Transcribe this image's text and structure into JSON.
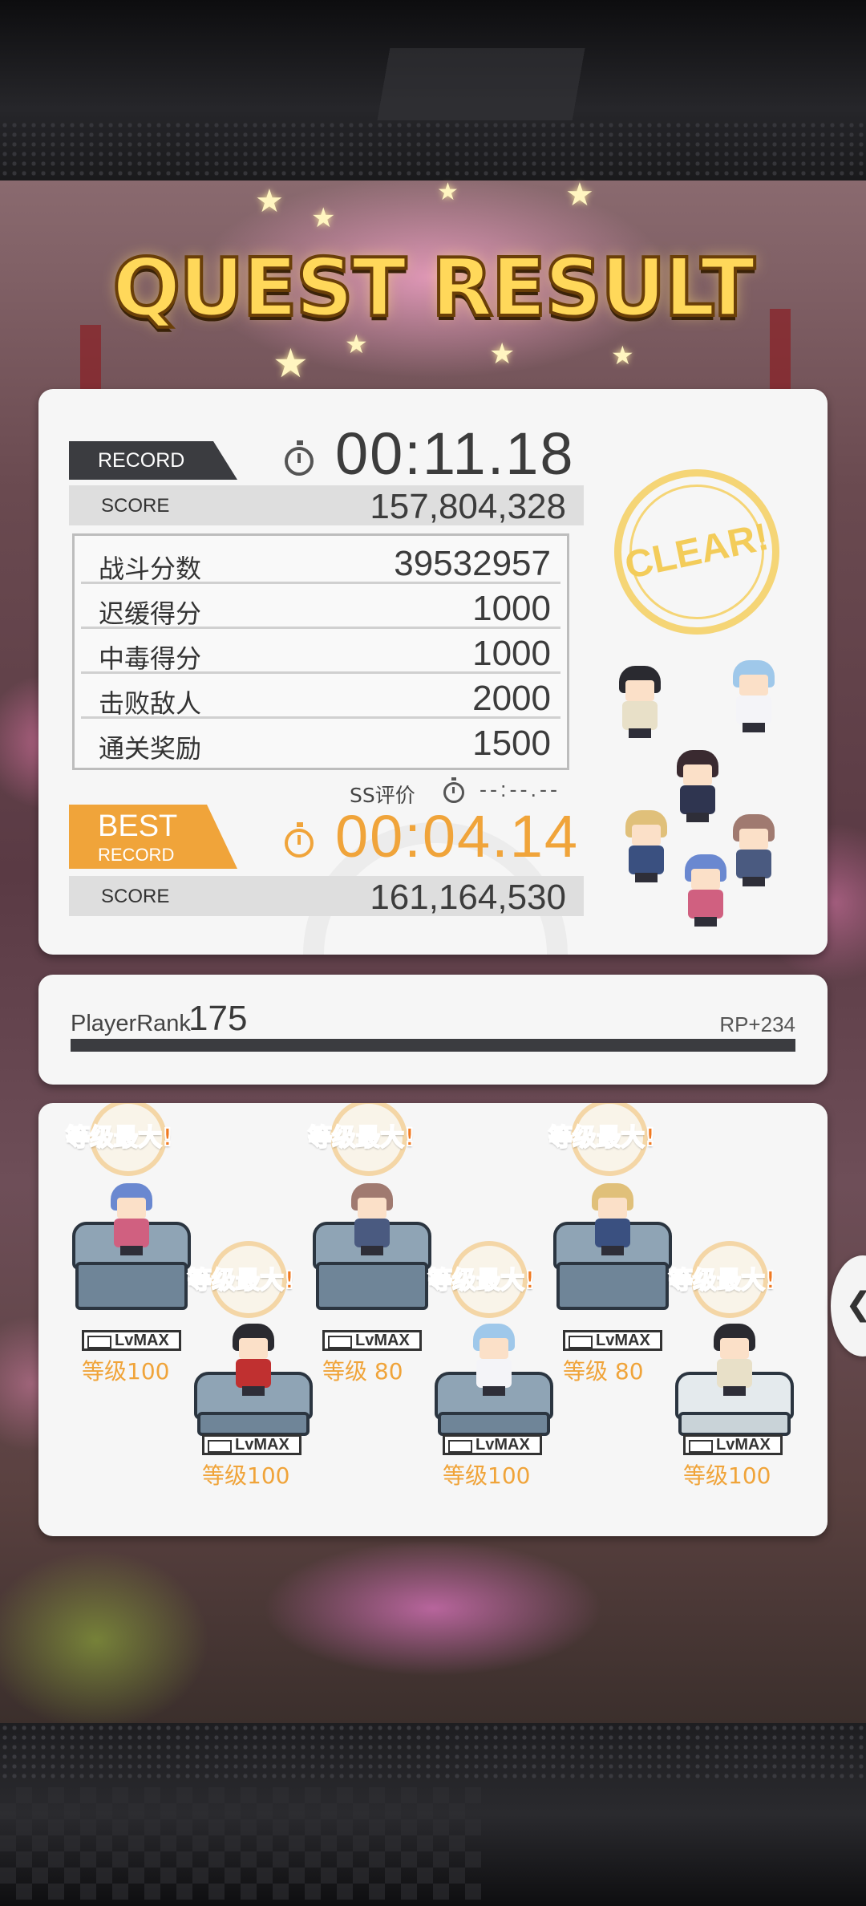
{
  "title": "QUEST RESULT",
  "record": {
    "tag": "RECORD",
    "time": "00:11.18",
    "score_label": "SCORE",
    "score": "157,804,328"
  },
  "details": [
    {
      "label": "战斗分数",
      "value": "39532957"
    },
    {
      "label": "迟缓得分",
      "value": "1000"
    },
    {
      "label": "中毒得分",
      "value": "1000"
    },
    {
      "label": "击败敌人",
      "value": "2000"
    },
    {
      "label": "通关奖励",
      "value": "1500"
    }
  ],
  "ss": {
    "label": "SS评价",
    "time": "--:--.--"
  },
  "best": {
    "tag_line1": "BEST",
    "tag_line2": "RECORD",
    "time": "00:04.14",
    "score_label": "SCORE",
    "score": "161,164,530"
  },
  "clear_stamp": "CLEAR!",
  "player_rank": {
    "label": "PlayerRank",
    "value": "175",
    "rp": "RP+234",
    "progress": 1.0
  },
  "party": [
    {
      "badge": "等级最大!",
      "lv_tag": "LvMAX",
      "level": "等级100"
    },
    {
      "badge": "等级最大!",
      "lv_tag": "LvMAX",
      "level": "等级100"
    },
    {
      "badge": "等级最大!",
      "lv_tag": "LvMAX",
      "level": "等级 80"
    },
    {
      "badge": "等级最大!",
      "lv_tag": "LvMAX",
      "level": "等级100"
    },
    {
      "badge": "等级最大!",
      "lv_tag": "LvMAX",
      "level": "等级 80"
    },
    {
      "badge": "等级最大!",
      "lv_tag": "LvMAX",
      "level": "等级100"
    }
  ],
  "colors": {
    "accent_orange": "#f0a43a",
    "dark_tag": "#3b3c40",
    "panel": "#f6f6f6",
    "title_gold": "#ffd85a",
    "clear_gold": "#f5d576"
  },
  "icons": {
    "timer": "stopwatch-icon",
    "side_button": "arrow-icon"
  }
}
